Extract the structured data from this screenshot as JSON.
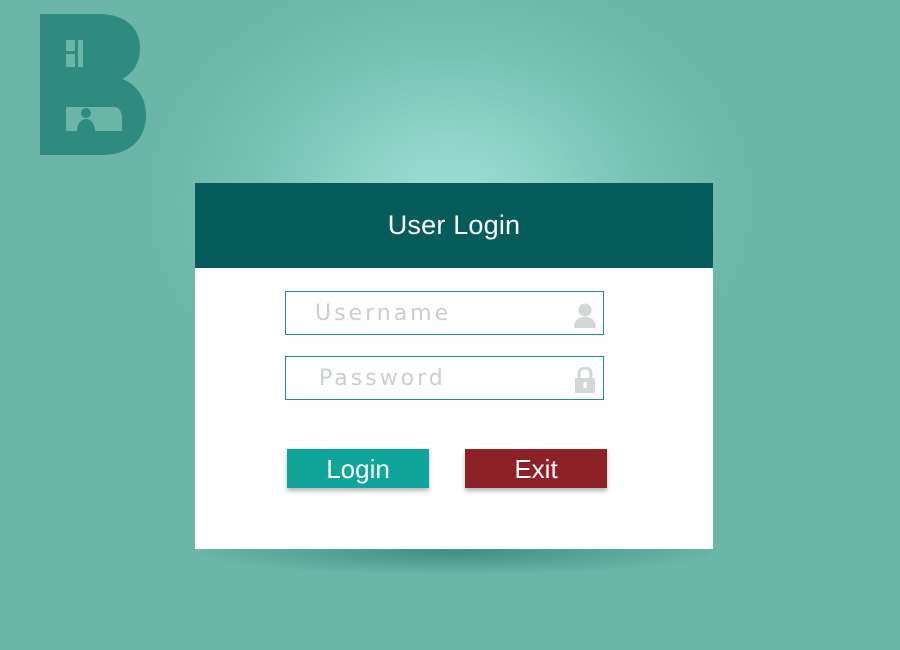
{
  "logo": {
    "letter": "B",
    "color": "#2f8a80"
  },
  "login_dialog": {
    "title": "User Login",
    "username": {
      "value": "",
      "placeholder": "Username",
      "icon": "user-icon"
    },
    "password": {
      "value": "",
      "placeholder": "Password",
      "icon": "lock-icon"
    },
    "login_button": "Login",
    "exit_button": "Exit"
  },
  "colors": {
    "background": "#6cb6a9",
    "header": "#065b5b",
    "login_button": "#0fa59a",
    "exit_button": "#8d2127",
    "field_border": "#1f8f85"
  }
}
